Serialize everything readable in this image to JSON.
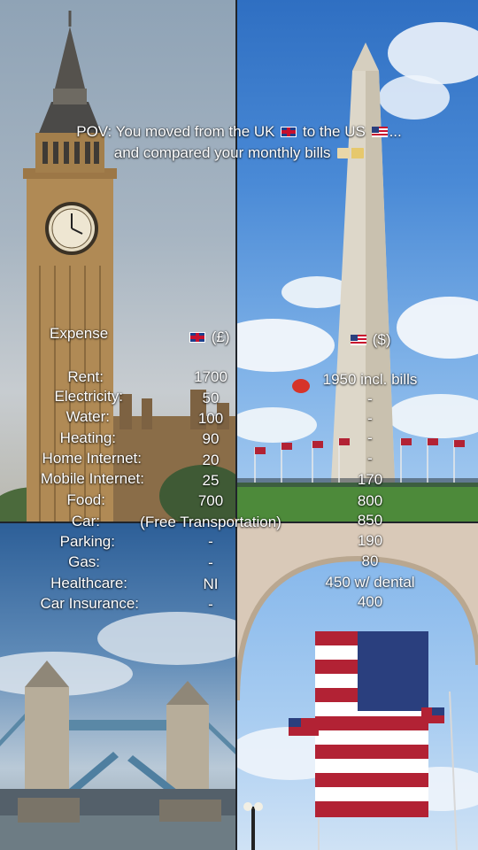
{
  "title": {
    "line1": "POV: You moved from the UK",
    "line1_mid": "to the US",
    "line1_end": "...",
    "line2": "and compared your monthly bills"
  },
  "table": {
    "headers": {
      "expense": "Expense",
      "uk": "(£)",
      "us": "($)"
    },
    "rows": [
      {
        "label": "Rent:",
        "uk": "1700",
        "us": "1950 incl. bills"
      },
      {
        "label": "Electricity:",
        "uk": "50",
        "us": "-"
      },
      {
        "label": "Water:",
        "uk": "100",
        "us": "-"
      },
      {
        "label": "Heating:",
        "uk": "90",
        "us": "-"
      },
      {
        "label": "Home Internet:",
        "uk": "20",
        "us": "-"
      },
      {
        "label": "Mobile Internet:",
        "uk": "25",
        "us": "170"
      },
      {
        "label": "Food:",
        "uk": "700",
        "us": "800"
      },
      {
        "label": "Car:",
        "uk": "(Free Transportation)",
        "us": "850"
      },
      {
        "label": "Parking:",
        "uk": "-",
        "us": "190"
      },
      {
        "label": "Gas:",
        "uk": "-",
        "us": "80"
      },
      {
        "label": "Healthcare:",
        "uk": "NI",
        "us": "450 w/ dental"
      },
      {
        "label": "Car Insurance:",
        "uk": "-",
        "us": "400"
      }
    ]
  },
  "icons": {
    "uk_flag": "uk-flag-icon",
    "us_flag": "us-flag-icon",
    "bills": "money-bills-icon"
  }
}
